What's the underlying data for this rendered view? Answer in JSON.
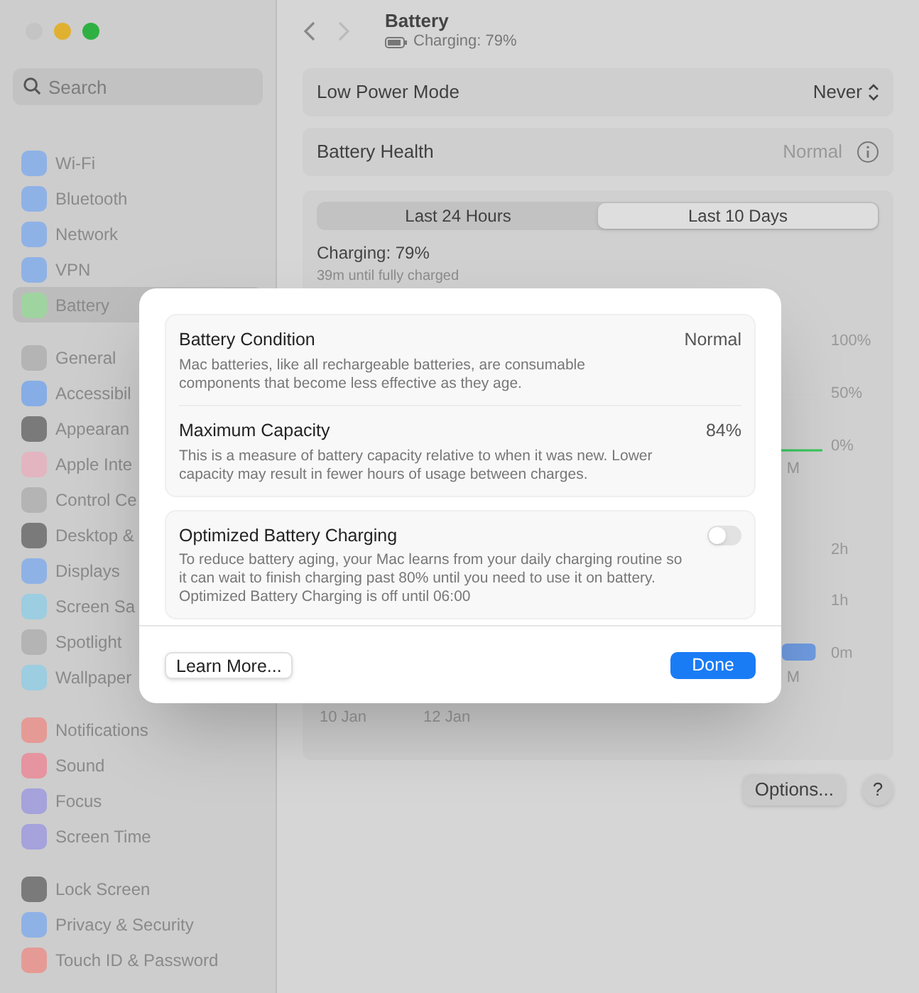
{
  "window": {
    "traffic_lights": [
      {
        "color": "#c4c4c4"
      },
      {
        "color": "#e0b031"
      },
      {
        "color": "#2fb043"
      }
    ]
  },
  "sidebar": {
    "search": {
      "placeholder": "Search"
    },
    "groups": [
      {
        "items": [
          {
            "label": "Wi-Fi",
            "color": "#8fb2e6",
            "selected": false
          },
          {
            "label": "Bluetooth",
            "color": "#8fb2e6",
            "selected": false
          },
          {
            "label": "Network",
            "color": "#8fb2e6",
            "selected": false
          },
          {
            "label": "VPN",
            "color": "#8fb2e6",
            "selected": false
          },
          {
            "label": "Battery",
            "color": "#9fd4a0",
            "selected": true
          }
        ]
      },
      {
        "items": [
          {
            "label": "General",
            "color": "#b4b4b4",
            "selected": false
          },
          {
            "label": "Accessibil",
            "color": "#86ade6",
            "selected": false
          },
          {
            "label": "Appearan",
            "color": "#7a7a7a",
            "selected": false
          },
          {
            "label": "Apple Inte",
            "color": "#e3b5c0",
            "selected": false
          },
          {
            "label": "Control Ce",
            "color": "#b4b4b4",
            "selected": false
          },
          {
            "label": "Desktop &",
            "color": "#7a7a7a",
            "selected": false
          },
          {
            "label": "Displays",
            "color": "#8fb2e6",
            "selected": false
          },
          {
            "label": "Screen Sa",
            "color": "#9ccde0",
            "selected": false
          },
          {
            "label": "Spotlight",
            "color": "#b4b4b4",
            "selected": false
          },
          {
            "label": "Wallpaper",
            "color": "#9ccde0",
            "selected": false
          }
        ]
      },
      {
        "items": [
          {
            "label": "Notifications",
            "color": "#e69a95",
            "selected": false
          },
          {
            "label": "Sound",
            "color": "#e6949f",
            "selected": false
          },
          {
            "label": "Focus",
            "color": "#a5a2dc",
            "selected": false
          },
          {
            "label": "Screen Time",
            "color": "#a5a2dc",
            "selected": false
          }
        ]
      },
      {
        "items": [
          {
            "label": "Lock Screen",
            "color": "#7a7a7a",
            "selected": false
          },
          {
            "label": "Privacy & Security",
            "color": "#8fb2e6",
            "selected": false
          },
          {
            "label": "Touch ID & Password",
            "color": "#e69a95",
            "selected": false
          }
        ]
      }
    ]
  },
  "header": {
    "title": "Battery",
    "subtitle": "Charging: 79%"
  },
  "rows": [
    {
      "kind": "popup",
      "label": "Low Power Mode",
      "value": "Never"
    },
    {
      "kind": "info",
      "label": "Battery Health",
      "value": "Normal"
    }
  ],
  "usage": {
    "tabs": [
      {
        "label": "Last 24 Hours",
        "selected": false
      },
      {
        "label": "Last 10 Days",
        "selected": true
      }
    ],
    "status": "Charging: 79%",
    "estimate": "39m until fully charged",
    "level_ticks": [
      "100%",
      "50%",
      "0%"
    ],
    "level_axis_fragment": "M",
    "usage_ticks": [
      "2h",
      "1h",
      "0m"
    ],
    "usage_axis_fragment": "M",
    "dates": [
      "10 Jan",
      "12 Jan"
    ]
  },
  "footer": {
    "options": "Options...",
    "help": "?"
  },
  "dialog": {
    "sections": [
      {
        "rows": [
          {
            "title": "Battery Condition",
            "value": "Normal",
            "text": "Mac batteries, like all rechargeable batteries, are consumable components that become less effective as they age."
          },
          {
            "title": "Maximum Capacity",
            "value": "84%",
            "text": "This is a measure of battery capacity relative to when it was new. Lower capacity may result in fewer hours of usage between charges."
          }
        ]
      },
      {
        "rows": [
          {
            "title": "Optimized Battery Charging",
            "on": false,
            "text": "To reduce battery aging, your Mac learns from your daily charging routine so it can wait to finish charging past 80% until you need to use it on battery. Optimized Battery Charging is off until 06:00"
          }
        ]
      }
    ],
    "buttons": [
      {
        "kind": "secondary",
        "label": "Learn More..."
      },
      {
        "kind": "primary",
        "label": "Done"
      }
    ]
  }
}
